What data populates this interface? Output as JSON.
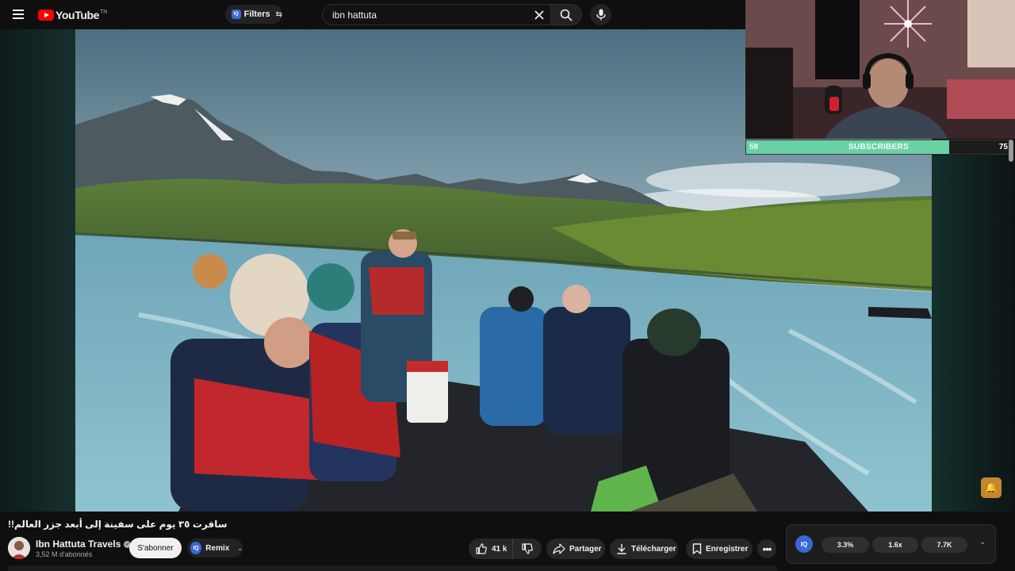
{
  "header": {
    "logo_text": "YouTube",
    "logo_region": "TN",
    "filters_label": "Filters",
    "filters_badge": "IQ",
    "search_value": "ibn hattuta"
  },
  "overlay": {
    "subscriber_goal_start": "58",
    "subscriber_goal_label": "SUBSCRIBERS",
    "subscriber_goal_end": "75",
    "subscriber_progress": 0.77
  },
  "video": {
    "title": "سافرت ٣٥ يوم على سفينة إلى أبعد جزر العالم!!",
    "channel_name": "Ibn Hattuta Travels",
    "channel_subs": "3,52 M d'abonnés",
    "subscribe_label": "S'abonner",
    "remix_label": "Remix",
    "remix_badge": "IQ"
  },
  "actions": {
    "like_count": "41 k",
    "share_label": "Partager",
    "download_label": "Télécharger",
    "save_label": "Enregistrer"
  },
  "iq_panel": {
    "badge": "IQ",
    "stats": [
      "3.3%",
      "1.6x",
      "7.7K"
    ]
  },
  "icons": {
    "menu": "hamburger-icon",
    "search": "search-icon",
    "clear": "close-icon",
    "mic": "mic-icon",
    "like": "thumbs-up-icon",
    "dislike": "thumbs-down-icon",
    "share": "share-arrow-icon",
    "download": "download-icon",
    "save": "bookmark-icon",
    "more": "more-horizontal-icon"
  },
  "colors": {
    "brand_red": "#ff0000",
    "goal_fill": "#6ad1a5",
    "iq_blue": "#3a66d6"
  }
}
